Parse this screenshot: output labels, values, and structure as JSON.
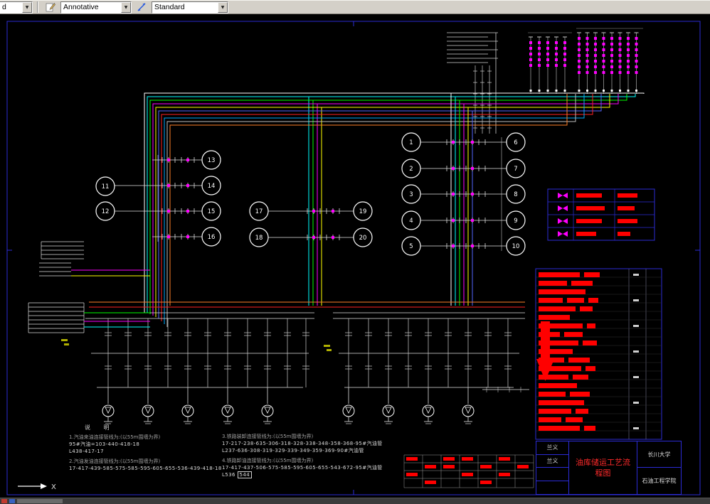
{
  "toolbar": {
    "layer_combo_value": "d",
    "annotative_combo_value": "Annotative",
    "standard_combo_value": "Standard"
  },
  "tanks": {
    "labels": [
      "1",
      "2",
      "3",
      "4",
      "5",
      "6",
      "7",
      "8",
      "9",
      "10",
      "11",
      "12",
      "13",
      "14",
      "15",
      "16",
      "17",
      "18",
      "19",
      "20"
    ]
  },
  "notes": {
    "heading": "说  明",
    "col1": [
      {
        "label": "1.汽油来油连接管线为:(以55m围墙为界)",
        "lines": [
          "95#汽油=103-440-418-18",
          "L438-417-17"
        ]
      },
      {
        "label": "2.汽油发油连接管线为:(以55m围墙为界)",
        "lines": [
          "17-417-439-585-575-585-595-605-655-536-439-418-18"
        ]
      }
    ],
    "col2": [
      {
        "label": "3.铁路装卸连接管线为:(以55m围墙为界)",
        "lines": [
          "17-217-238-635-306-318-328-338-348-358-368-95#汽油管",
          "L237-636-308-319-329-339-349-359-369-90#汽油管"
        ]
      },
      {
        "label": "4.铁路卸油连接管线为:(以55m围墙为界)",
        "lines": [
          "17-417-437-506-575-585-595-605-655-543-672-95#汽油管",
          "L536"
        ],
        "boxed": "544"
      }
    ]
  },
  "titleblock": {
    "names": [
      "兰义",
      "兰义"
    ],
    "title": "油库储运工艺流程图",
    "school": "长川大学",
    "college": "石油工程学院"
  },
  "ucs": {
    "axis_label": "X"
  },
  "colors": {
    "canvas_bg": "#000000",
    "toolbar_bg": "#d4d0c8",
    "frame_blue": "#2b2bd5",
    "annotation_red": "#ff0000",
    "valve_magenta": "#ff00ff",
    "pipe_palette": [
      "#ffffff",
      "#00ffff",
      "#00ff00",
      "#ff00ff",
      "#ffff00",
      "#5566ff",
      "#ff2222",
      "#00aaff",
      "#bbbbbb",
      "#ff7f27"
    ]
  },
  "redacted": {
    "legend_rows": [
      [
        36,
        28
      ],
      [
        40,
        24
      ],
      [
        36,
        28
      ],
      [
        28,
        18
      ]
    ],
    "table_rows": [
      [
        58,
        22
      ],
      [
        40,
        30
      ],
      [
        66
      ],
      [
        34,
        24,
        14
      ],
      [
        52,
        18
      ],
      [
        44
      ],
      [
        62,
        12
      ],
      [
        30,
        26
      ],
      [
        56,
        20
      ],
      [
        48
      ],
      [
        36,
        30
      ],
      [
        60,
        14
      ],
      [
        42,
        22
      ],
      [
        54
      ],
      [
        38,
        28
      ],
      [
        64
      ],
      [
        46,
        18
      ],
      [
        32,
        24
      ],
      [
        58,
        16
      ]
    ],
    "rev_cells": [
      [
        0,
        0
      ],
      [
        0,
        2
      ],
      [
        0,
        3
      ],
      [
        0,
        5
      ],
      [
        1,
        1
      ],
      [
        1,
        2
      ],
      [
        1,
        4
      ],
      [
        1,
        6
      ],
      [
        2,
        0
      ],
      [
        2,
        3
      ],
      [
        2,
        5
      ],
      [
        3,
        1
      ],
      [
        3,
        4
      ]
    ]
  }
}
